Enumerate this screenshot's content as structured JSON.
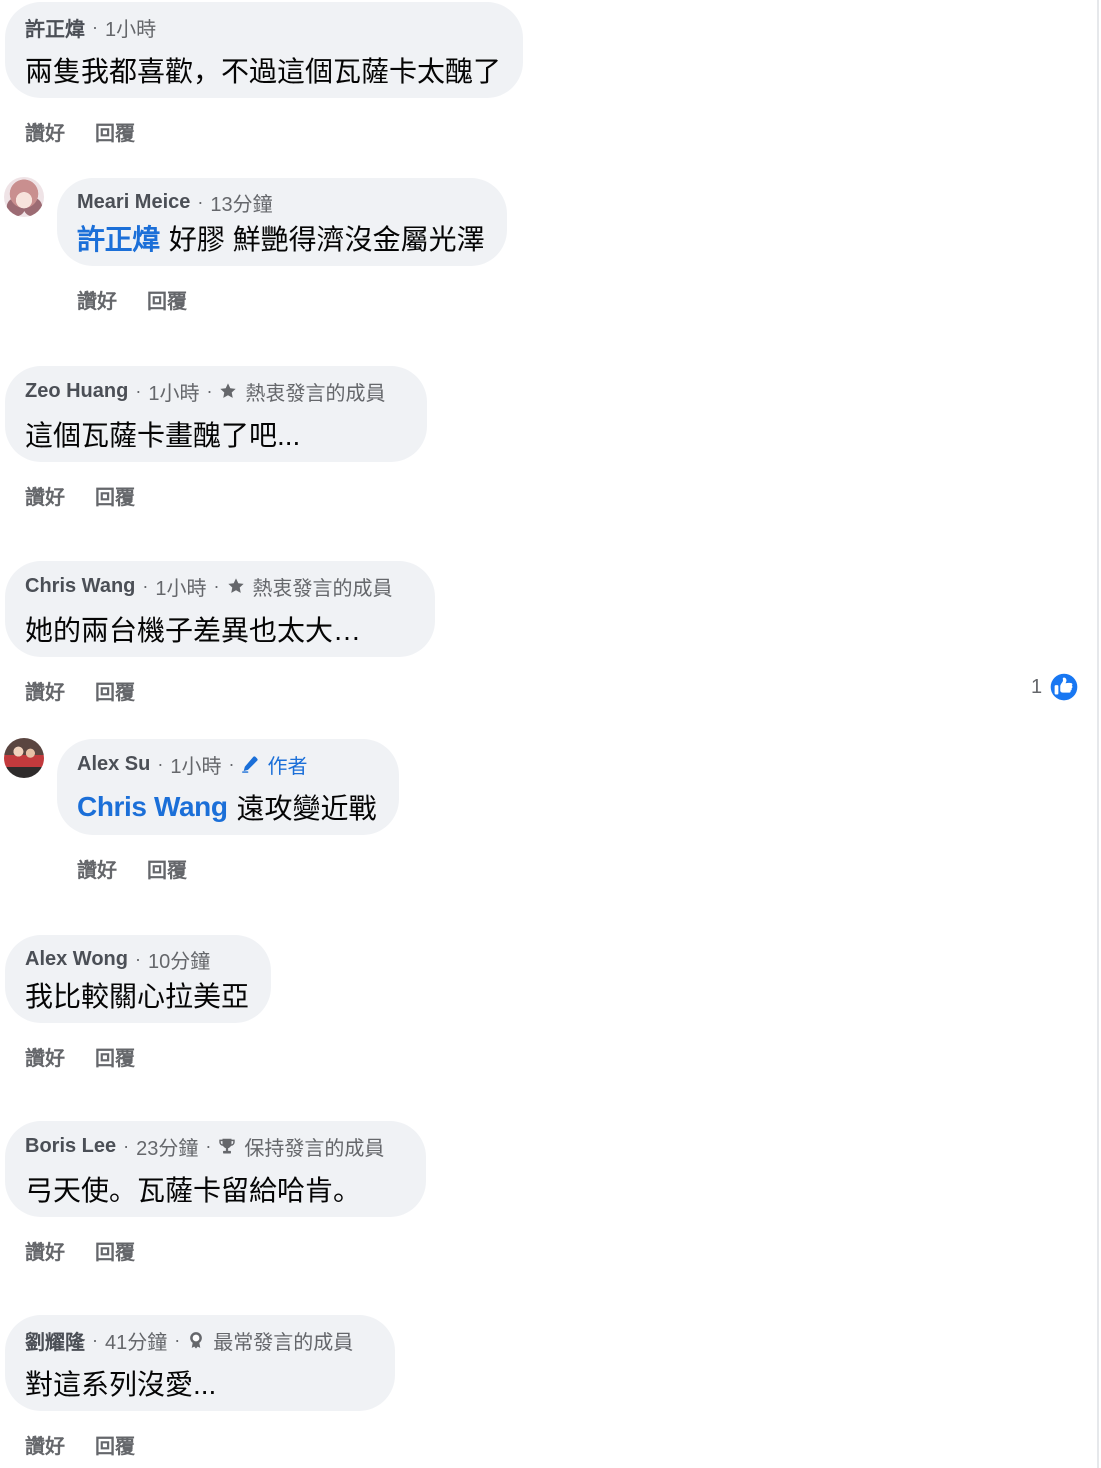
{
  "separator": "·",
  "actions": {
    "like": "讚好",
    "reply": "回覆"
  },
  "colors": {
    "bubble": "#f0f2f5",
    "primary_text": "#050505",
    "secondary_text": "#65676b",
    "author_text": "#4b4f56",
    "mention": "#1b6fd8",
    "like_blue": "#1877f2"
  },
  "comments": [
    {
      "author": "許正煒",
      "time": "1小時",
      "text": "兩隻我都喜歡，不過這個瓦薩卡太醜了",
      "replies": [
        {
          "author": "Meari Meice",
          "time": "13分鐘",
          "mention": "許正煒",
          "text": "好膠 鮮艷得濟沒金屬光澤"
        }
      ]
    },
    {
      "author": "Zeo Huang",
      "time": "1小時",
      "badge": {
        "icon": "star-icon",
        "label": "熱衷發言的成員"
      },
      "text": "這個瓦薩卡畫醜了吧..."
    },
    {
      "author": "Chris Wang",
      "time": "1小時",
      "badge": {
        "icon": "star-icon",
        "label": "熱衷發言的成員"
      },
      "text": "她的兩台機子差異也太大…",
      "reaction": {
        "icon": "like-icon",
        "count": "1"
      },
      "replies": [
        {
          "author": "Alex Su",
          "time": "1小時",
          "badge": {
            "icon": "pencil-icon",
            "label": "作者"
          },
          "mention": "Chris Wang",
          "text": "遠攻變近戰"
        }
      ]
    },
    {
      "author": "Alex Wong",
      "time": "10分鐘",
      "text": "我比較關心拉美亞"
    },
    {
      "author": "Boris Lee",
      "time": "23分鐘",
      "badge": {
        "icon": "trophy-icon",
        "label": "保持發言的成員"
      },
      "text": "弓天使。瓦薩卡留給哈肯。"
    },
    {
      "author": "劉耀隆",
      "time": "41分鐘",
      "badge": {
        "icon": "medal-icon",
        "label": "最常發言的成員"
      },
      "text": "對這系列沒愛..."
    }
  ]
}
